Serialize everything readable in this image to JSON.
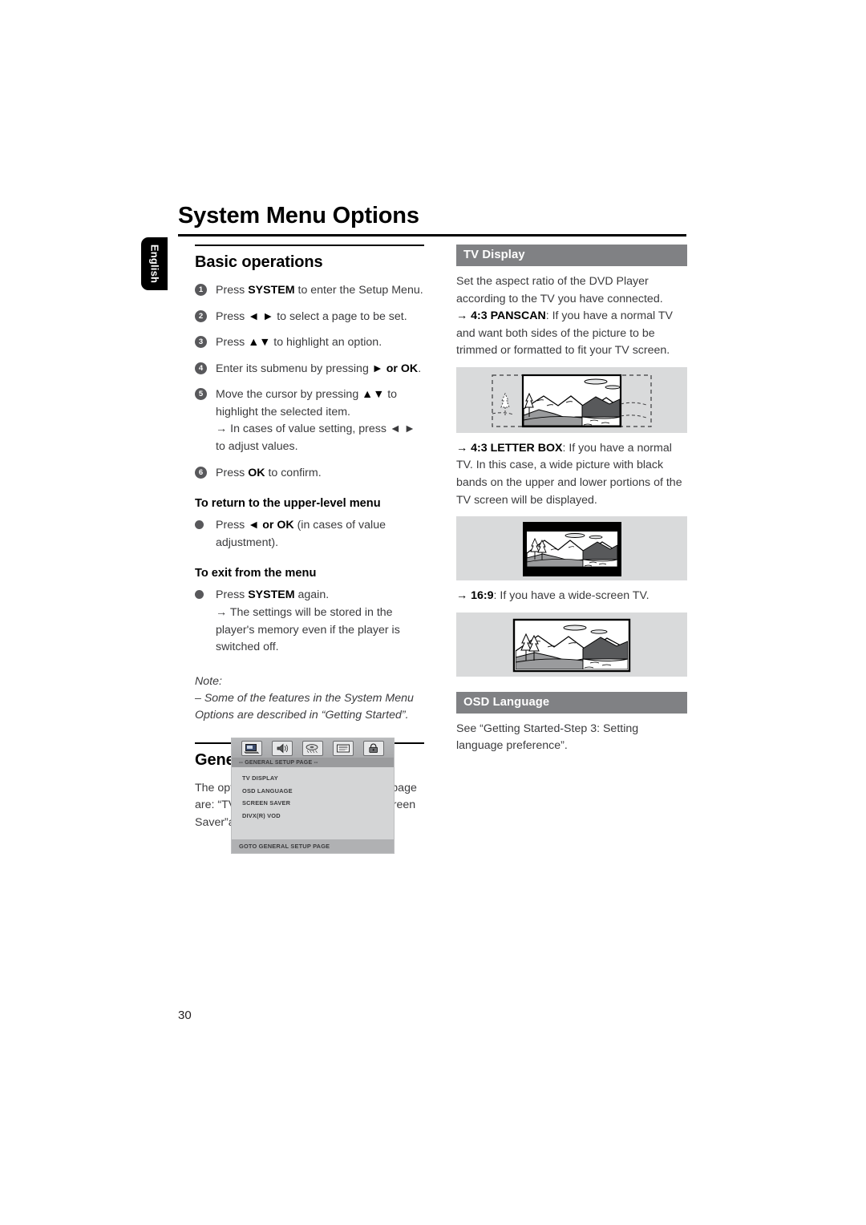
{
  "page": {
    "title": "System Menu Options",
    "language_tab": "English",
    "page_number": "30"
  },
  "left_column": {
    "basic_operations": {
      "heading": "Basic operations",
      "steps": [
        {
          "num": "1",
          "text_before": "Press ",
          "bold": "SYSTEM",
          "text_after": " to enter the Setup Menu."
        },
        {
          "num": "2",
          "text_before": "Press ",
          "bold": "◄ ►",
          "text_after": " to select a page to be set."
        },
        {
          "num": "3",
          "text_before": "Press ",
          "bold": "▲▼",
          "text_after": " to highlight an option."
        },
        {
          "num": "4",
          "text_before": "Enter its submenu by pressing ",
          "bold": "► or OK",
          "text_after": "."
        },
        {
          "num": "5",
          "text_before": "Move the cursor by pressing ",
          "bold": "▲▼",
          "text_after": " to highlight the selected item."
        },
        {
          "num": "6",
          "text_before": "Press ",
          "bold": "OK",
          "text_after": " to confirm."
        }
      ],
      "step5_sub": "→ In cases of value setting, press ◄ ► to adjust values.",
      "return_heading": "To return to the upper-level menu",
      "return_bullet_before": "Press ",
      "return_bullet_bold": "◄ or OK",
      "return_bullet_after": " (in cases of value adjustment).",
      "exit_heading": "To exit from the menu",
      "exit_bullet_before": "Press ",
      "exit_bullet_bold": "SYSTEM",
      "exit_bullet_after": " again.",
      "exit_sub": "→ The settings will be stored in the player's memory even if the player is switched off.",
      "note_label": "Note:",
      "note_text": "–   Some of the features in the System Menu Options are described in “Getting Started”."
    },
    "general_setup": {
      "heading": "General Setup Page",
      "intro": "The options included in General Setup page are: “TV Display”,“OSD Language”, “Screen Saver”and  “DIVX(R) VOD”."
    },
    "osd_menu": {
      "title_bar": "-- GENERAL SETUP PAGE --",
      "icons": [
        "general-setup-icon",
        "audio-setup-icon",
        "video-setup-icon",
        "preference-setup-icon",
        "password-lock-icon"
      ],
      "items": [
        "TV DISPLAY",
        "OSD LANGUAGE",
        "SCREEN SAVER",
        "DIVX(R) VOD"
      ],
      "footer": "GOTO GENERAL SETUP PAGE"
    }
  },
  "right_column": {
    "tv_display": {
      "header": "TV Display",
      "intro": "Set the aspect ratio of the DVD Player according to the TV you have connected.",
      "panscan_arrow": "→ ",
      "panscan_bold": "4:3 PANSCAN",
      "panscan_text": ": If you have a normal TV and want both sides of the picture to be trimmed or formatted to fit your TV screen.",
      "letterbox_arrow": "→ ",
      "letterbox_bold": "4:3 LETTER BOX",
      "letterbox_text": ": If you have a normal TV. In this case, a wide picture with black bands on the upper and lower portions of the TV screen will be displayed.",
      "widescreen_arrow": "→ ",
      "widescreen_bold": "16:9",
      "widescreen_text": ": If you have a wide-screen TV.",
      "illustrations": [
        "panscan-tv-illustration",
        "letterbox-tv-illustration",
        "widescreen-tv-illustration"
      ]
    },
    "osd_language": {
      "header": "OSD Language",
      "text": "See “Getting Started-Step 3: Setting language preference”."
    }
  },
  "colors": {
    "header_gray": "#808184",
    "illustration_bg": "#d9dadb",
    "bullet_gray": "#58585b",
    "text_gray": "#3b3b3d"
  }
}
